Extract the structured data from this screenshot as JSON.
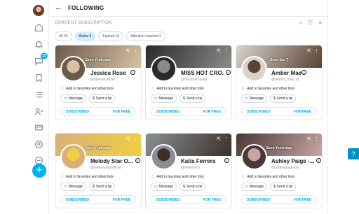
{
  "header": {
    "back": "←",
    "title": "FOLLOWING"
  },
  "subheader": "CURRENT SUBSCRIPTION",
  "sidebar": {
    "messages_badge": "15"
  },
  "filters": [
    {
      "label": "All 25",
      "active": false
    },
    {
      "label": "Active 9",
      "active": true
    },
    {
      "label": "Expired 16",
      "active": false
    },
    {
      "label": "Attention required 2",
      "active": false
    }
  ],
  "cards": [
    {
      "seen": "Seen Yesterday",
      "name": "Jessica Rose",
      "handle": "@itsjessicarose",
      "colors": [
        "#6a5a4a",
        "#d9c2a3"
      ]
    },
    {
      "seen": "",
      "name": "MISS HOT CRO...",
      "handle": "@misshotcroatia",
      "colors": [
        "#2a2a2a",
        "#8a8a8a"
      ]
    },
    {
      "seen": "Seen Jan 7",
      "name": "Amber Mae",
      "handle": "@amber_mae_uk",
      "colors": [
        "#d9d3cb",
        "#5a4335"
      ]
    },
    {
      "seen": "Seen Yesterday",
      "name": "Melody Star O...",
      "handle": "@melodystarofficial",
      "colors": [
        "#d8b07a",
        "#f0d040"
      ]
    },
    {
      "seen": "",
      "name": "Katia Ferrera",
      "handle": "@theferrera",
      "colors": [
        "#8a8f95",
        "#3a3028"
      ]
    },
    {
      "seen": "Seen Yesterday",
      "name": "Ashley Paige -...",
      "handle": "@ashleypaigexxx",
      "colors": [
        "#4a3838",
        "#c7a5a0"
      ]
    }
  ],
  "card_labels": {
    "favorites": "Add to favorites and other lists",
    "message": "Message",
    "tip": "Send a tip",
    "subscribed": "SUBSCRIBED",
    "free": "FOR FREE"
  },
  "help": "?"
}
